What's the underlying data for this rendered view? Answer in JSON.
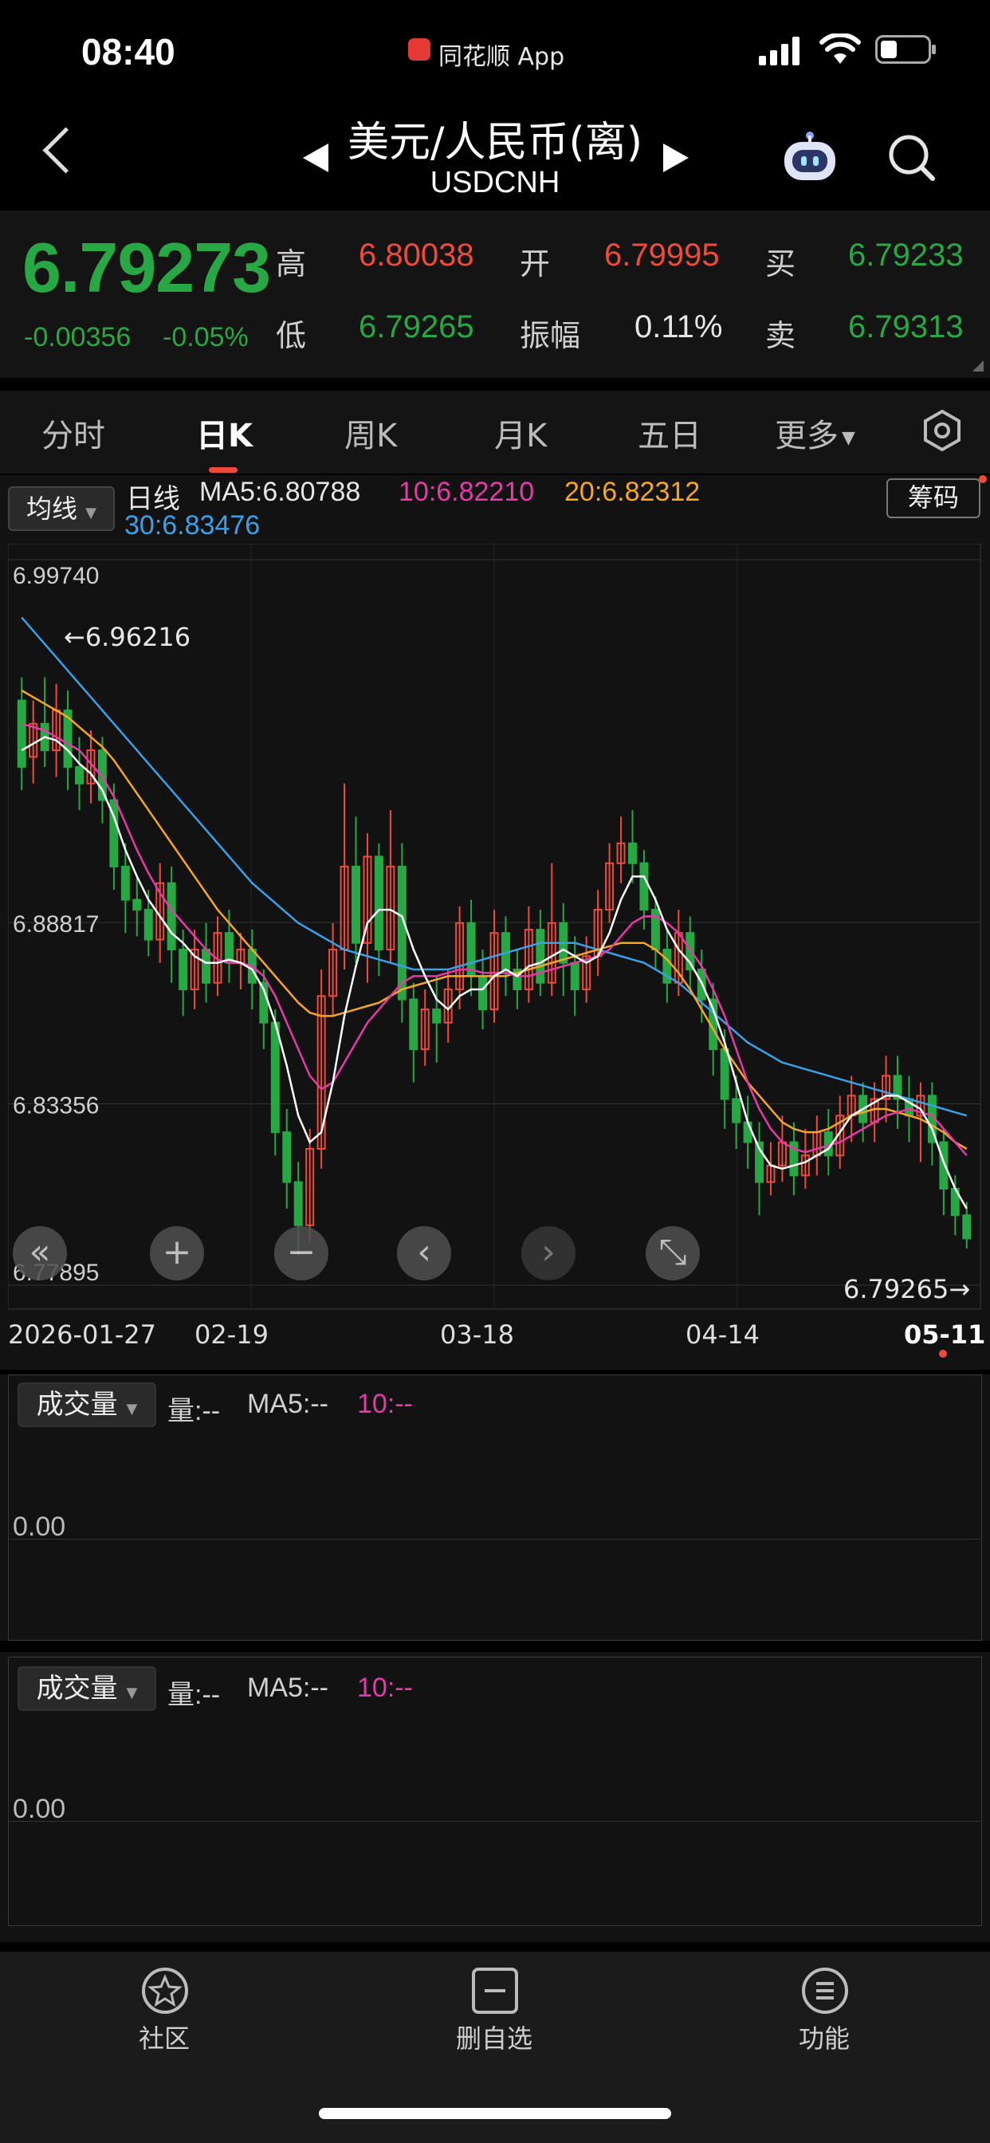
{
  "status": {
    "time": "08:40",
    "app": "同花顺 App"
  },
  "header": {
    "title": "美元/人民币(离)",
    "code": "USDCNH"
  },
  "quote": {
    "price": "6.79273",
    "change": "-0.00356",
    "change_pct": "-0.05%",
    "high_label": "高",
    "high": "6.80038",
    "open_label": "开",
    "open": "6.79995",
    "buy_label": "买",
    "buy": "6.79233",
    "low_label": "低",
    "low": "6.79265",
    "amp_label": "振幅",
    "amplitude": "0.11%",
    "sell_label": "卖",
    "sell": "6.79313"
  },
  "tabs": [
    "分时",
    "日K",
    "周K",
    "月K",
    "五日",
    "更多"
  ],
  "active_tab": 1,
  "indicator": {
    "selector": "均线",
    "period": "日线",
    "ma5": "MA5:6.80788",
    "ma10": "10:6.82210",
    "ma20": "20:6.82312",
    "ma30": "30:6.83476",
    "chip_button": "筹码"
  },
  "colors": {
    "up": "#f04a3a",
    "down": "#27a844",
    "ma5": "#ffffff",
    "ma10": "#e63aa8",
    "ma20": "#f6a623",
    "ma30": "#3aa0e8"
  },
  "chart_data": {
    "type": "candlestick",
    "y_ticks": [
      "6.99740",
      "6.88817",
      "6.83356",
      "6.77895"
    ],
    "ylim": [
      6.77895,
      6.9974
    ],
    "max_marker": "←6.96216",
    "min_marker": "6.79265→",
    "x_labels": [
      "2026-01-27",
      "02-19",
      "03-18",
      "04-14",
      "05-11"
    ],
    "grid": true,
    "candles": [
      [
        6.955,
        6.935,
        6.962,
        6.928
      ],
      [
        6.938,
        6.948,
        6.955,
        6.93
      ],
      [
        6.948,
        6.94,
        6.962,
        6.935
      ],
      [
        6.94,
        6.952,
        6.96,
        6.932
      ],
      [
        6.952,
        6.935,
        6.958,
        6.928
      ],
      [
        6.935,
        6.93,
        6.944,
        6.922
      ],
      [
        6.93,
        6.94,
        6.946,
        6.924
      ],
      [
        6.94,
        6.925,
        6.944,
        6.918
      ],
      [
        6.925,
        6.905,
        6.93,
        6.898
      ],
      [
        6.905,
        6.895,
        6.912,
        6.885
      ],
      [
        6.895,
        6.892,
        6.902,
        6.884
      ],
      [
        6.892,
        6.883,
        6.898,
        6.878
      ],
      [
        6.883,
        6.9,
        6.906,
        6.876
      ],
      [
        6.9,
        6.88,
        6.905,
        6.87
      ],
      [
        6.88,
        6.868,
        6.886,
        6.86
      ],
      [
        6.868,
        6.88,
        6.886,
        6.862
      ],
      [
        6.88,
        6.87,
        6.888,
        6.864
      ],
      [
        6.87,
        6.885,
        6.89,
        6.866
      ],
      [
        6.885,
        6.876,
        6.892,
        6.87
      ],
      [
        6.876,
        6.88,
        6.885,
        6.868
      ],
      [
        6.88,
        6.87,
        6.886,
        6.862
      ],
      [
        6.87,
        6.858,
        6.874,
        6.85
      ],
      [
        6.858,
        6.825,
        6.862,
        6.818
      ],
      [
        6.825,
        6.81,
        6.832,
        6.802
      ],
      [
        6.81,
        6.797,
        6.816,
        6.788
      ],
      [
        6.797,
        6.82,
        6.826,
        6.792
      ],
      [
        6.82,
        6.866,
        6.874,
        6.814
      ],
      [
        6.866,
        6.88,
        6.888,
        6.86
      ],
      [
        6.88,
        6.905,
        6.93,
        6.874
      ],
      [
        6.905,
        6.882,
        6.92,
        6.876
      ],
      [
        6.882,
        6.908,
        6.915,
        6.87
      ],
      [
        6.908,
        6.88,
        6.912,
        6.872
      ],
      [
        6.88,
        6.905,
        6.922,
        6.876
      ],
      [
        6.905,
        6.865,
        6.912,
        6.858
      ],
      [
        6.865,
        6.85,
        6.87,
        6.84
      ],
      [
        6.85,
        6.862,
        6.868,
        6.845
      ],
      [
        6.862,
        6.858,
        6.872,
        6.846
      ],
      [
        6.858,
        6.868,
        6.874,
        6.852
      ],
      [
        6.868,
        6.888,
        6.893,
        6.862
      ],
      [
        6.888,
        6.872,
        6.895,
        6.866
      ],
      [
        6.872,
        6.862,
        6.88,
        6.856
      ],
      [
        6.862,
        6.885,
        6.892,
        6.858
      ],
      [
        6.885,
        6.874,
        6.89,
        6.866
      ],
      [
        6.874,
        6.868,
        6.88,
        6.862
      ],
      [
        6.868,
        6.886,
        6.893,
        6.864
      ],
      [
        6.886,
        6.87,
        6.892,
        6.866
      ],
      [
        6.87,
        6.888,
        6.906,
        6.866
      ],
      [
        6.888,
        6.876,
        6.894,
        6.866
      ],
      [
        6.876,
        6.868,
        6.884,
        6.86
      ],
      [
        6.868,
        6.878,
        6.884,
        6.864
      ],
      [
        6.878,
        6.892,
        6.898,
        6.872
      ],
      [
        6.892,
        6.906,
        6.912,
        6.888
      ],
      [
        6.906,
        6.912,
        6.92,
        6.9
      ],
      [
        6.912,
        6.906,
        6.922,
        6.9
      ],
      [
        6.906,
        6.892,
        6.91,
        6.886
      ],
      [
        6.892,
        6.88,
        6.896,
        6.874
      ],
      [
        6.88,
        6.87,
        6.886,
        6.864
      ],
      [
        6.87,
        6.885,
        6.892,
        6.866
      ],
      [
        6.885,
        6.874,
        6.89,
        6.868
      ],
      [
        6.874,
        6.865,
        6.88,
        6.858
      ],
      [
        6.865,
        6.85,
        6.87,
        6.842
      ],
      [
        6.85,
        6.835,
        6.856,
        6.826
      ],
      [
        6.835,
        6.828,
        6.842,
        6.82
      ],
      [
        6.828,
        6.822,
        6.836,
        6.814
      ],
      [
        6.822,
        6.81,
        6.828,
        6.8
      ],
      [
        6.81,
        6.815,
        6.822,
        6.806
      ],
      [
        6.815,
        6.822,
        6.83,
        6.81
      ],
      [
        6.822,
        6.812,
        6.828,
        6.806
      ],
      [
        6.812,
        6.818,
        6.826,
        6.808
      ],
      [
        6.818,
        6.825,
        6.83,
        6.812
      ],
      [
        6.825,
        6.818,
        6.832,
        6.812
      ],
      [
        6.818,
        6.83,
        6.836,
        6.814
      ],
      [
        6.83,
        6.836,
        6.842,
        6.822
      ],
      [
        6.836,
        6.828,
        6.84,
        6.822
      ],
      [
        6.828,
        6.835,
        6.84,
        6.822
      ],
      [
        6.835,
        6.842,
        6.848,
        6.828
      ],
      [
        6.842,
        6.835,
        6.848,
        6.826
      ],
      [
        6.835,
        6.83,
        6.842,
        6.822
      ],
      [
        6.83,
        6.836,
        6.84,
        6.816
      ],
      [
        6.836,
        6.822,
        6.84,
        6.815
      ],
      [
        6.822,
        6.808,
        6.826,
        6.8
      ],
      [
        6.808,
        6.8,
        6.812,
        6.794
      ],
      [
        6.8,
        6.793,
        6.804,
        6.79
      ]
    ],
    "ma5": [
      6.94,
      6.942,
      6.944,
      6.943,
      6.94,
      6.936,
      6.933,
      6.928,
      6.92,
      6.91,
      6.902,
      6.895,
      6.89,
      6.885,
      6.882,
      6.878,
      6.876,
      6.876,
      6.877,
      6.876,
      6.874,
      6.868,
      6.858,
      6.845,
      6.83,
      6.822,
      6.825,
      6.84,
      6.86,
      6.875,
      6.888,
      6.892,
      6.892,
      6.89,
      6.88,
      6.872,
      6.865,
      6.862,
      6.866,
      6.868,
      6.868,
      6.872,
      6.874,
      6.872,
      6.875,
      6.876,
      6.878,
      6.88,
      6.878,
      6.876,
      6.878,
      6.885,
      6.895,
      6.902,
      6.902,
      6.895,
      6.886,
      6.88,
      6.876,
      6.87,
      6.862,
      6.852,
      6.84,
      6.828,
      6.82,
      6.815,
      6.814,
      6.815,
      6.816,
      6.818,
      6.82,
      6.825,
      6.83,
      6.832,
      6.834,
      6.836,
      6.836,
      6.834,
      6.832,
      6.826,
      6.816,
      6.808,
      6.802
    ],
    "ma10": [
      6.948,
      6.947,
      6.946,
      6.944,
      6.942,
      6.94,
      6.936,
      6.932,
      6.926,
      6.918,
      6.91,
      6.903,
      6.897,
      6.892,
      6.888,
      6.884,
      6.88,
      6.877,
      6.876,
      6.876,
      6.875,
      6.872,
      6.866,
      6.858,
      6.85,
      6.842,
      6.838,
      6.84,
      6.846,
      6.852,
      6.858,
      6.862,
      6.866,
      6.87,
      6.872,
      6.872,
      6.872,
      6.873,
      6.874,
      6.874,
      6.873,
      6.873,
      6.873,
      6.872,
      6.872,
      6.873,
      6.874,
      6.875,
      6.876,
      6.877,
      6.878,
      6.88,
      6.884,
      6.888,
      6.89,
      6.89,
      6.888,
      6.885,
      6.88,
      6.875,
      6.868,
      6.86,
      6.85,
      6.84,
      6.832,
      6.826,
      6.822,
      6.82,
      6.819,
      6.82,
      6.821,
      6.822,
      6.824,
      6.826,
      6.828,
      6.83,
      6.831,
      6.832,
      6.831,
      6.83,
      6.826,
      6.822,
      6.818
    ],
    "ma20": [
      6.958,
      6.956,
      6.954,
      6.952,
      6.95,
      6.947,
      6.944,
      6.941,
      6.937,
      6.932,
      6.927,
      6.922,
      6.917,
      6.912,
      6.907,
      6.902,
      6.897,
      6.892,
      6.888,
      6.884,
      6.88,
      6.876,
      6.872,
      6.868,
      6.864,
      6.861,
      6.86,
      6.86,
      6.861,
      6.862,
      6.863,
      6.864,
      6.866,
      6.868,
      6.869,
      6.87,
      6.871,
      6.872,
      6.872,
      6.872,
      6.872,
      6.872,
      6.872,
      6.873,
      6.874,
      6.875,
      6.876,
      6.877,
      6.878,
      6.879,
      6.88,
      6.881,
      6.882,
      6.882,
      6.882,
      6.88,
      6.877,
      6.873,
      6.868,
      6.862,
      6.856,
      6.85,
      6.845,
      6.84,
      6.836,
      6.832,
      6.828,
      6.826,
      6.825,
      6.825,
      6.826,
      6.828,
      6.83,
      6.831,
      6.832,
      6.832,
      6.831,
      6.83,
      6.829,
      6.827,
      6.825,
      6.822,
      6.82
    ],
    "ma30": [
      6.98,
      6.976,
      6.972,
      6.968,
      6.964,
      6.96,
      6.956,
      6.952,
      6.948,
      6.944,
      6.94,
      6.936,
      6.932,
      6.928,
      6.924,
      6.92,
      6.916,
      6.912,
      6.908,
      6.904,
      6.9,
      6.897,
      6.894,
      6.891,
      6.888,
      6.886,
      6.884,
      6.882,
      6.88,
      6.879,
      6.878,
      6.877,
      6.876,
      6.875,
      6.874,
      6.874,
      6.874,
      6.874,
      6.875,
      6.876,
      6.877,
      6.878,
      6.879,
      6.88,
      6.881,
      6.882,
      6.882,
      6.882,
      6.882,
      6.881,
      6.88,
      6.879,
      6.878,
      6.877,
      6.876,
      6.874,
      6.872,
      6.87,
      6.867,
      6.864,
      6.861,
      6.858,
      6.855,
      6.852,
      6.85,
      6.848,
      6.846,
      6.845,
      6.844,
      6.843,
      6.842,
      6.841,
      6.84,
      6.839,
      6.838,
      6.837,
      6.836,
      6.835,
      6.834,
      6.833,
      6.832,
      6.831,
      6.83
    ]
  },
  "chart_controls": [
    "«",
    "+",
    "−",
    "‹",
    "›",
    "⤡"
  ],
  "volume_panels": [
    {
      "selector": "成交量",
      "vol": "量:--",
      "ma5": "MA5:--",
      "ma10": "10:--",
      "axis": "0.00"
    },
    {
      "selector": "成交量",
      "vol": "量:--",
      "ma5": "MA5:--",
      "ma10": "10:--",
      "axis": "0.00"
    }
  ],
  "bottom_nav": [
    {
      "label": "社区",
      "icon": "community-icon"
    },
    {
      "label": "删自选",
      "icon": "remove-watchlist-icon"
    },
    {
      "label": "功能",
      "icon": "menu-icon"
    }
  ]
}
